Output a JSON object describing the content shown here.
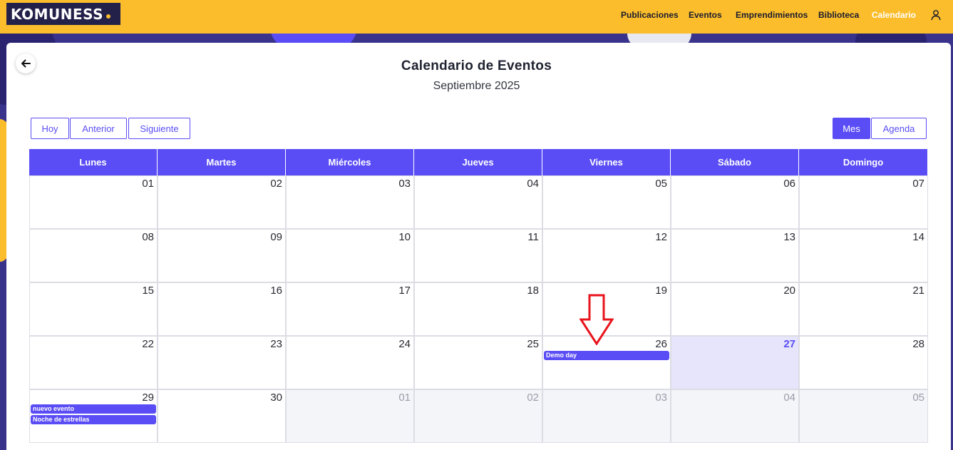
{
  "brand": {
    "logo_text": "KOMUNESS"
  },
  "nav": {
    "items": [
      {
        "label": "Publicaciones",
        "active": false
      },
      {
        "label": "Eventos",
        "active": false
      },
      {
        "label": "Emprendimientos",
        "active": false
      },
      {
        "label": "Biblioteca",
        "active": false
      },
      {
        "label": "Calendario",
        "active": true
      }
    ],
    "user_icon": "user-icon"
  },
  "page": {
    "title": "Calendario de Eventos",
    "subtitle": "Septiembre 2025",
    "back_icon": "arrow-left-icon"
  },
  "toolbar": {
    "today_label": "Hoy",
    "prev_label": "Anterior",
    "next_label": "Siguiente",
    "month_label": "Mes",
    "agenda_label": "Agenda",
    "active_view": "Mes"
  },
  "calendar": {
    "weekdays": [
      "Lunes",
      "Martes",
      "Miércoles",
      "Jueves",
      "Viernes",
      "Sábado",
      "Domingo"
    ],
    "weeks": [
      [
        {
          "num": "01"
        },
        {
          "num": "02"
        },
        {
          "num": "03"
        },
        {
          "num": "04"
        },
        {
          "num": "05"
        },
        {
          "num": "06"
        },
        {
          "num": "07"
        }
      ],
      [
        {
          "num": "08"
        },
        {
          "num": "09"
        },
        {
          "num": "10"
        },
        {
          "num": "11"
        },
        {
          "num": "12"
        },
        {
          "num": "13"
        },
        {
          "num": "14"
        }
      ],
      [
        {
          "num": "15"
        },
        {
          "num": "16"
        },
        {
          "num": "17"
        },
        {
          "num": "18"
        },
        {
          "num": "19"
        },
        {
          "num": "20"
        },
        {
          "num": "21"
        }
      ],
      [
        {
          "num": "22"
        },
        {
          "num": "23"
        },
        {
          "num": "24"
        },
        {
          "num": "25"
        },
        {
          "num": "26",
          "events": [
            "Demo day"
          ]
        },
        {
          "num": "27",
          "today": true
        },
        {
          "num": "28"
        }
      ],
      [
        {
          "num": "29",
          "events": [
            "nuevo evento",
            "Noche de estrellas"
          ]
        },
        {
          "num": "30"
        },
        {
          "num": "01",
          "other": true
        },
        {
          "num": "02",
          "other": true
        },
        {
          "num": "03",
          "other": true
        },
        {
          "num": "04",
          "other": true
        },
        {
          "num": "05",
          "other": true
        }
      ]
    ]
  },
  "colors": {
    "brand_yellow": "#fbbd2b",
    "accent": "#5a4df5",
    "today_bg": "#e6e5fb",
    "annotation_arrow": "#e8141c"
  }
}
